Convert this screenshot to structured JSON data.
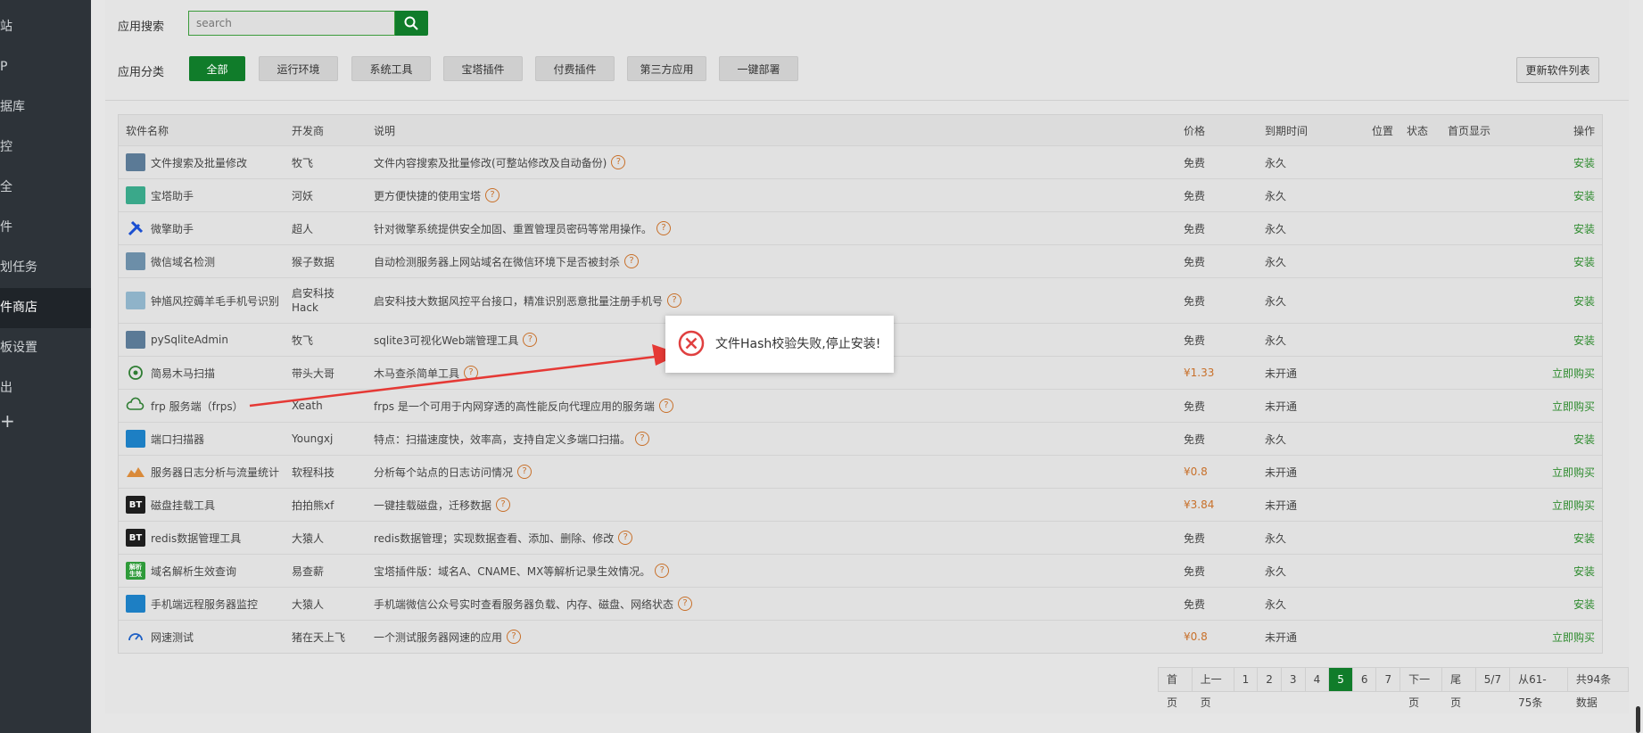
{
  "sidebar": {
    "items": [
      {
        "label": "站"
      },
      {
        "label": "P"
      },
      {
        "label": "据库"
      },
      {
        "label": "控"
      },
      {
        "label": "全"
      },
      {
        "label": "件"
      },
      {
        "label": "划任务"
      },
      {
        "label": "件商店"
      },
      {
        "label": "板设置"
      },
      {
        "label": "出"
      }
    ],
    "add_icon": "plus-icon"
  },
  "search": {
    "label": "应用搜索",
    "placeholder": "search",
    "button_icon": "search-icon"
  },
  "categories": {
    "label": "应用分类",
    "items": [
      "全部",
      "运行环境",
      "系统工具",
      "宝塔插件",
      "付费插件",
      "第三方应用",
      "一键部署"
    ],
    "active": "全部"
  },
  "refresh_button": "更新软件列表",
  "table": {
    "headers": {
      "name": "软件名称",
      "dev": "开发商",
      "desc": "说明",
      "price": "价格",
      "expire": "到期时间",
      "position": "位置",
      "state": "状态",
      "home": "首页显示",
      "op": "操作"
    },
    "rows": [
      {
        "name": "文件搜索及批量修改",
        "dev": "牧飞",
        "desc": "文件内容搜索及批量修改(可整站修改及自动备份)",
        "price": "免费",
        "expire": "永久",
        "op": "安装"
      },
      {
        "name": "宝塔助手",
        "dev": "河妖",
        "desc": "更方便快捷的使用宝塔",
        "price": "免费",
        "expire": "永久",
        "op": "安装"
      },
      {
        "name": "微擎助手",
        "dev": "超人",
        "desc": "针对微擎系统提供安全加固、重置管理员密码等常用操作。",
        "price": "免费",
        "expire": "永久",
        "op": "安装"
      },
      {
        "name": "微信域名检测",
        "dev": "猴子数据",
        "desc": "自动检测服务器上网站域名在微信环境下是否被封杀",
        "price": "免费",
        "expire": "永久",
        "op": "安装"
      },
      {
        "name": "钟馗风控薅羊毛手机号识别",
        "dev": "启安科技Hack",
        "dev_line1": "启安科技",
        "dev_line2": "Hack",
        "desc": "启安科技大数据风控平台接口，精准识别恶意批量注册手机号",
        "price": "免费",
        "expire": "永久",
        "op": "安装"
      },
      {
        "name": "pySqliteAdmin",
        "dev": "牧飞",
        "desc": "sqlite3可视化Web端管理工具",
        "price": "免费",
        "expire": "永久",
        "op": "安装"
      },
      {
        "name": "简易木马扫描",
        "dev": "带头大哥",
        "desc": "木马查杀简单工具",
        "price": "¥1.33",
        "expire": "未开通",
        "op": "立即购买"
      },
      {
        "name": "frp 服务端（frps）",
        "dev": "Xeath",
        "desc": "frps 是一个可用于内网穿透的高性能反向代理应用的服务端",
        "price": "免费",
        "expire": "未开通",
        "op": "立即购买"
      },
      {
        "name": "端口扫描器",
        "dev": "Youngxj",
        "desc": "特点：扫描速度快，效率高，支持自定义多端口扫描。",
        "price": "免费",
        "expire": "永久",
        "op": "安装"
      },
      {
        "name": "服务器日志分析与流量统计",
        "dev": "软程科技",
        "desc": "分析每个站点的日志访问情况",
        "price": "¥0.8",
        "expire": "未开通",
        "op": "立即购买"
      },
      {
        "name": "磁盘挂载工具",
        "dev": "拍拍熊xf",
        "desc": "一键挂载磁盘，迁移数据",
        "price": "¥3.84",
        "expire": "未开通",
        "op": "立即购买"
      },
      {
        "name": "redis数据管理工具",
        "dev": "大猿人",
        "desc": "redis数据管理；实现数据查看、添加、删除、修改",
        "price": "免费",
        "expire": "永久",
        "op": "安装"
      },
      {
        "name": "域名解析生效查询",
        "dev": "易查薪",
        "desc": "宝塔插件版：域名A、CNAME、MX等解析记录生效情况。",
        "price": "免费",
        "expire": "永久",
        "op": "安装"
      },
      {
        "name": "手机端远程服务器监控",
        "dev": "大猿人",
        "desc": "手机端微信公众号实时查看服务器负载、内存、磁盘、网络状态",
        "price": "免费",
        "expire": "永久",
        "op": "安装"
      },
      {
        "name": "网速测试",
        "dev": "猪在天上飞",
        "desc": "一个测试服务器网速的应用",
        "price": "¥0.8",
        "expire": "未开通",
        "op": "立即购买"
      }
    ]
  },
  "icons": [
    "photo-icon",
    "assistant-icon",
    "tools-icon",
    "wechat-check-icon",
    "grid-icon",
    "photo-icon",
    "target-icon",
    "cloud-icon",
    "scanner-icon",
    "mountain-chart-icon",
    "bt-icon",
    "bt-icon",
    "dns-icon",
    "monitor-icon",
    "speedometer-icon"
  ],
  "icon_texts": {
    "bt": "BT",
    "dns": "解析\n生效"
  },
  "pagination": {
    "items": [
      "首页",
      "上一页",
      "1",
      "2",
      "3",
      "4",
      "5",
      "6",
      "7",
      "下一页",
      "尾页",
      "5/7",
      "从61-75条",
      "共94条数据"
    ],
    "current": "5"
  },
  "dialog": {
    "message": "文件Hash校验失败,停止安装!",
    "icon": "error-icon"
  },
  "colors": {
    "accent": "#107c2a",
    "paid": "#c8702a",
    "install": "#2e8b2e",
    "error": "#e04040",
    "arrow": "#e53935",
    "sidebar_bg": "#2d3339"
  }
}
